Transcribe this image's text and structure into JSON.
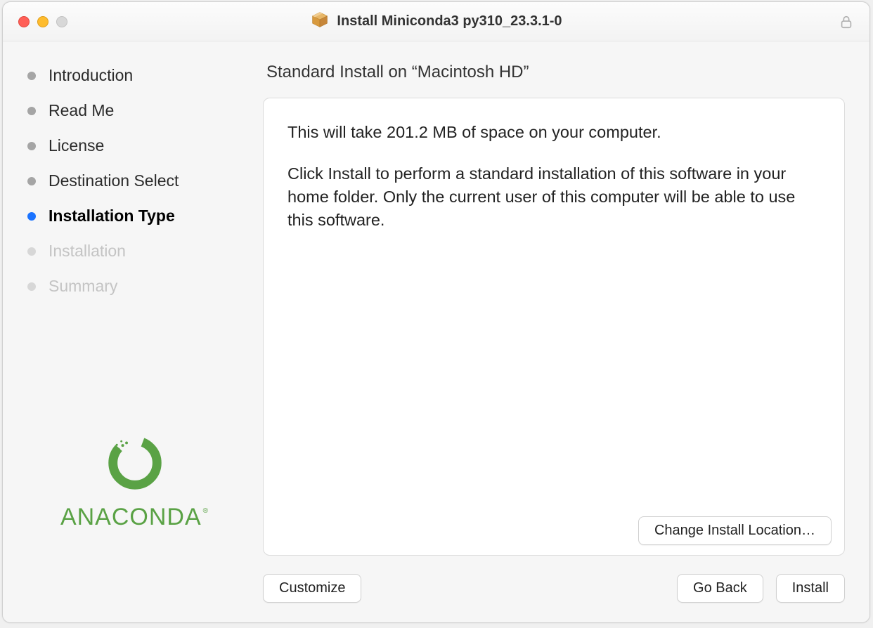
{
  "window": {
    "title": "Install Miniconda3 py310_23.3.1-0"
  },
  "sidebar": {
    "steps": [
      {
        "label": "Introduction",
        "state": "completed"
      },
      {
        "label": "Read Me",
        "state": "completed"
      },
      {
        "label": "License",
        "state": "completed"
      },
      {
        "label": "Destination Select",
        "state": "completed"
      },
      {
        "label": "Installation Type",
        "state": "current"
      },
      {
        "label": "Installation",
        "state": "pending"
      },
      {
        "label": "Summary",
        "state": "pending"
      }
    ],
    "brand_text": "ANACONDA"
  },
  "main": {
    "heading": "Standard Install on “Macintosh HD”",
    "paragraph1": "This will take 201.2 MB of space on your computer.",
    "paragraph2": "Click Install to perform a standard installation of this software in your home folder. Only the current user of this computer will be able to use this software.",
    "change_location_label": "Change Install Location…"
  },
  "footer": {
    "customize_label": "Customize",
    "goback_label": "Go Back",
    "install_label": "Install"
  }
}
